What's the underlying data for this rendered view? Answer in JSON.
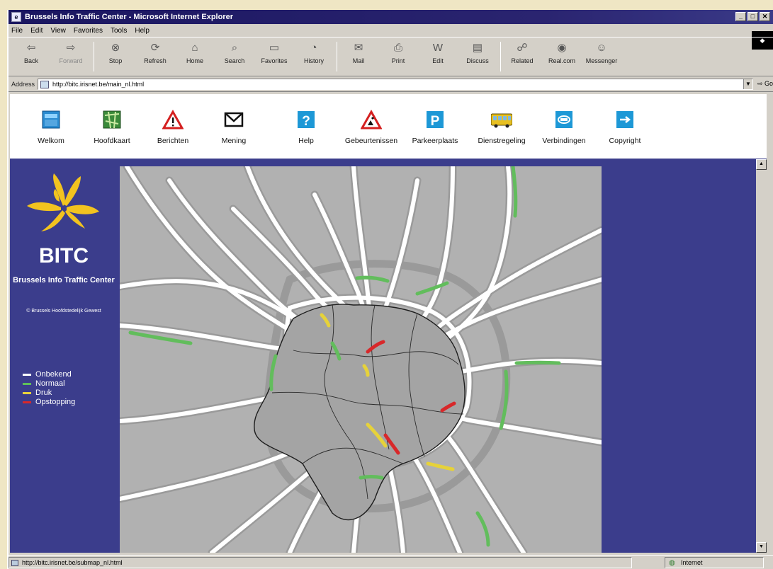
{
  "window": {
    "title": "Brussels Info Traffic Center - Microsoft Internet Explorer"
  },
  "menu": [
    "File",
    "Edit",
    "View",
    "Favorites",
    "Tools",
    "Help"
  ],
  "toolbar": [
    {
      "label": "Back",
      "icon": "back-arrow-icon",
      "glyph": "⇦",
      "enabled": true
    },
    {
      "label": "Forward",
      "icon": "forward-arrow-icon",
      "glyph": "⇨",
      "enabled": false
    },
    {
      "label": "Stop",
      "icon": "stop-icon",
      "glyph": "⊗",
      "enabled": true
    },
    {
      "label": "Refresh",
      "icon": "refresh-icon",
      "glyph": "⟳",
      "enabled": true
    },
    {
      "label": "Home",
      "icon": "home-icon",
      "glyph": "⌂",
      "enabled": true
    },
    {
      "label": "Search",
      "icon": "search-icon",
      "glyph": "⌕",
      "enabled": true
    },
    {
      "label": "Favorites",
      "icon": "favorites-icon",
      "glyph": "▭",
      "enabled": true
    },
    {
      "label": "History",
      "icon": "history-icon",
      "glyph": "◔",
      "enabled": true
    },
    {
      "label": "Mail",
      "icon": "mail-icon",
      "glyph": "✉",
      "enabled": true
    },
    {
      "label": "Print",
      "icon": "print-icon",
      "glyph": "⎙",
      "enabled": true
    },
    {
      "label": "Edit",
      "icon": "edit-icon",
      "glyph": "W",
      "enabled": true
    },
    {
      "label": "Discuss",
      "icon": "discuss-icon",
      "glyph": "▤",
      "enabled": true
    },
    {
      "label": "Related",
      "icon": "related-icon",
      "glyph": "☍",
      "enabled": true
    },
    {
      "label": "Real.com",
      "icon": "realcom-icon",
      "glyph": "◉",
      "enabled": true
    },
    {
      "label": "Messenger",
      "icon": "messenger-icon",
      "glyph": "☺",
      "enabled": true
    }
  ],
  "address": {
    "label": "Address",
    "url": "http://bitc.irisnet.be/main_nl.html",
    "go": "Go"
  },
  "nav": [
    {
      "label": "Welkom",
      "icon": "welcome-icon"
    },
    {
      "label": "Hoofdkaart",
      "icon": "main-map-icon"
    },
    {
      "label": "Berichten",
      "icon": "warning-triangle-icon"
    },
    {
      "label": "Mening",
      "icon": "envelope-icon"
    },
    {
      "label": "Help",
      "icon": "help-icon"
    },
    {
      "label": "Gebeurtenissen",
      "icon": "roadworks-icon"
    },
    {
      "label": "Parkeerplaats",
      "icon": "parking-icon"
    },
    {
      "label": "Dienstregeling",
      "icon": "bus-icon"
    },
    {
      "label": "Verbindingen",
      "icon": "links-icon"
    },
    {
      "label": "Copyright",
      "icon": "copyright-icon"
    }
  ],
  "brand": {
    "name": "BITC",
    "subtitle": "Brussels Info Traffic Center",
    "credit": "© Brussels Hoofdstedelijk Gewest"
  },
  "legend": [
    {
      "label": "Onbekend",
      "color": "#ffffff"
    },
    {
      "label": "Normaal",
      "color": "#5fbf5a"
    },
    {
      "label": "Druk",
      "color": "#e8d23c"
    },
    {
      "label": "Opstopping",
      "color": "#d8282a"
    }
  ],
  "status": {
    "url": "http://bitc.irisnet.be/submap_nl.html",
    "zone": "Internet"
  },
  "colors": {
    "sidebar": "#3b3d8c",
    "map": "#b1b1b1",
    "normal": "#5fbf5a",
    "busy": "#e8d23c",
    "jam": "#d8282a"
  }
}
